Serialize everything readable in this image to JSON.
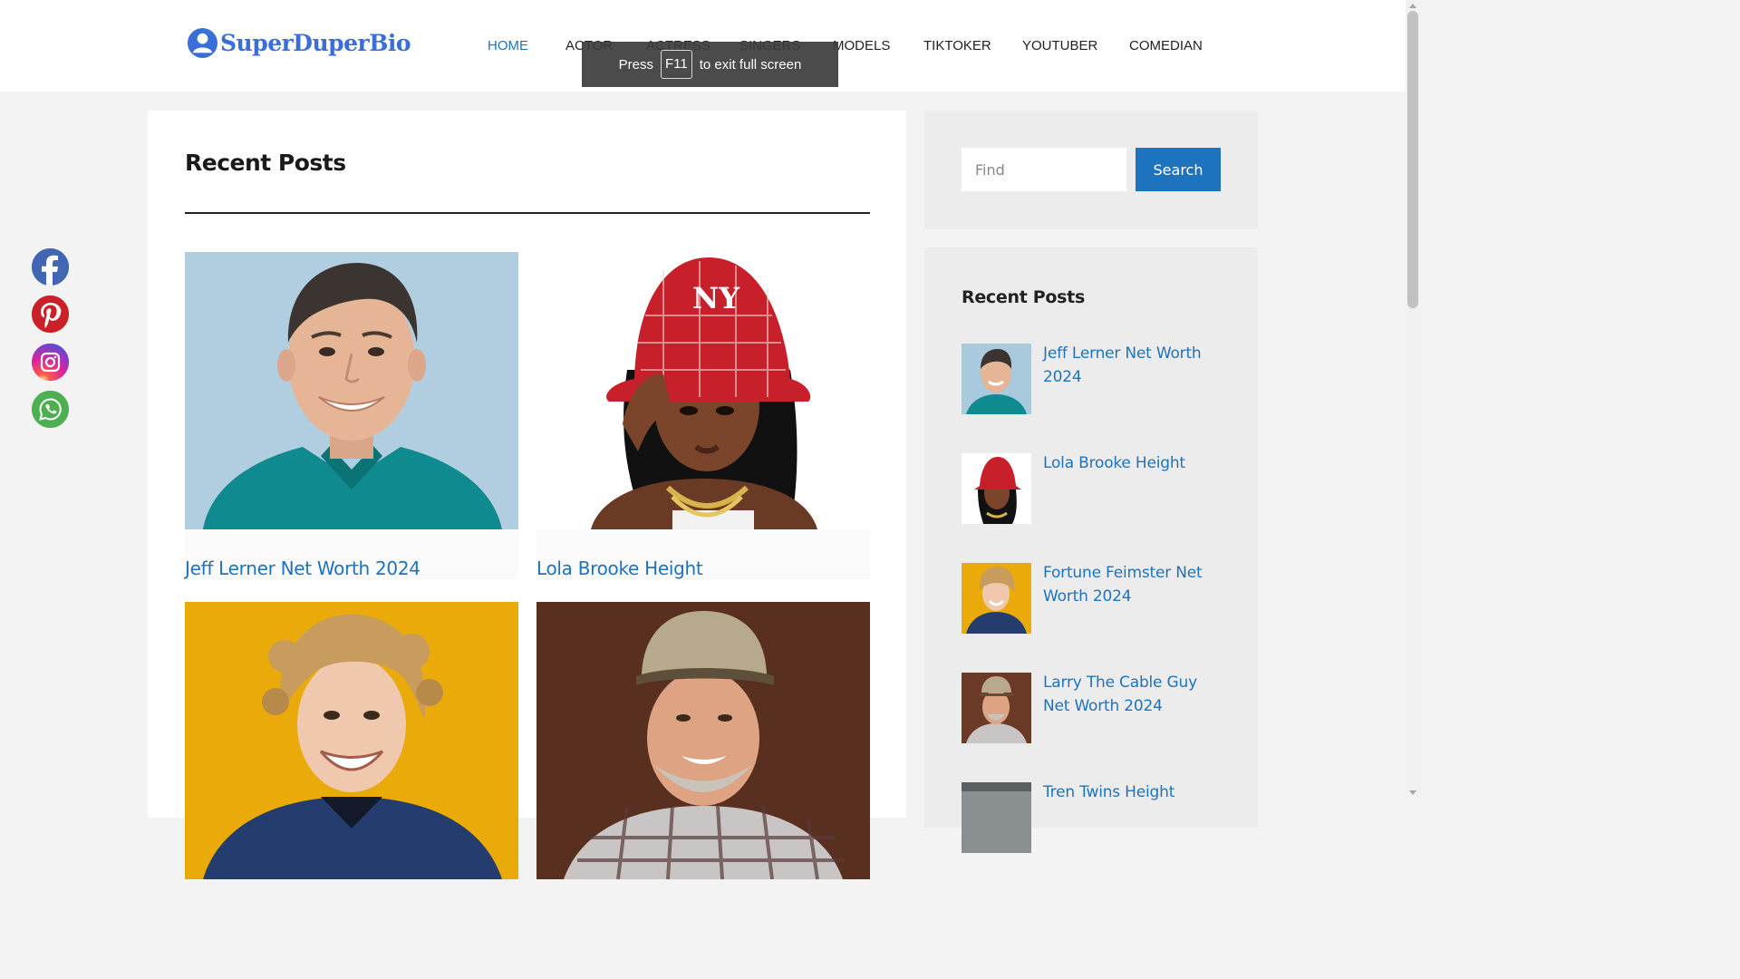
{
  "site": {
    "logo_text": "SuperDuperBio",
    "brand_color": "#3a6ed8",
    "link_color": "#1e73be"
  },
  "nav": {
    "items": [
      "HOME",
      "ACTOR",
      "ACTRESS",
      "SINGERS",
      "MODELS",
      "TIKTOKER",
      "YOUTUBER",
      "COMEDIAN"
    ],
    "active": "HOME"
  },
  "fullscreen_notice": {
    "before": "Press",
    "key": "F11",
    "after": "to exit full screen"
  },
  "main": {
    "title": "Recent Posts",
    "posts": [
      {
        "title": "Jeff Lerner Net Worth 2024",
        "image": "portrait-man-teal-polo"
      },
      {
        "title": "Lola Brooke Height",
        "image": "portrait-woman-red-bucket-hat"
      },
      {
        "title": "",
        "image": "portrait-woman-curly-hair-yellow-bg"
      },
      {
        "title": "",
        "image": "portrait-man-cap-plaid-shirt"
      }
    ]
  },
  "search": {
    "placeholder": "Find",
    "button_label": "Search"
  },
  "sidebar": {
    "title": "Recent Posts",
    "items": [
      {
        "label": "Jeff Lerner Net Worth 2024"
      },
      {
        "label": "Lola Brooke Height"
      },
      {
        "label": "Fortune Feimster Net Worth 2024"
      },
      {
        "label": "Larry The Cable Guy Net Worth 2024"
      },
      {
        "label": "Tren Twins Height"
      }
    ]
  },
  "social": [
    {
      "name": "facebook-icon",
      "color": "#3b5998"
    },
    {
      "name": "pinterest-icon",
      "color": "#cb2027"
    },
    {
      "name": "instagram-icon",
      "color": "#d6249f"
    },
    {
      "name": "whatsapp-icon",
      "color": "#4caf50"
    }
  ]
}
